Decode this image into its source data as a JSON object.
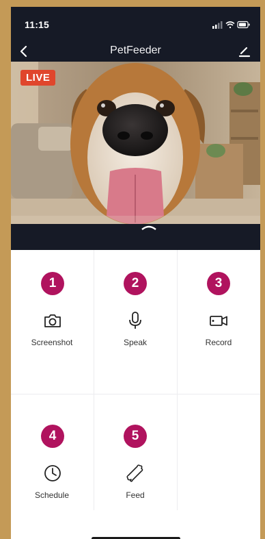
{
  "status_bar": {
    "time": "11:15"
  },
  "nav": {
    "title": "PetFeeder"
  },
  "video": {
    "live_label": "LIVE"
  },
  "controls": [
    {
      "number": "1",
      "label": "Screenshot",
      "icon": "camera-icon"
    },
    {
      "number": "2",
      "label": "Speak",
      "icon": "microphone-icon"
    },
    {
      "number": "3",
      "label": "Record",
      "icon": "video-camera-icon"
    },
    {
      "number": "4",
      "label": "Schedule",
      "icon": "clock-icon"
    },
    {
      "number": "5",
      "label": "Feed",
      "icon": "bone-icon"
    }
  ],
  "colors": {
    "frame": "#c49a57",
    "header": "#161a26",
    "live": "#e0462c",
    "badge": "#b0135e"
  }
}
